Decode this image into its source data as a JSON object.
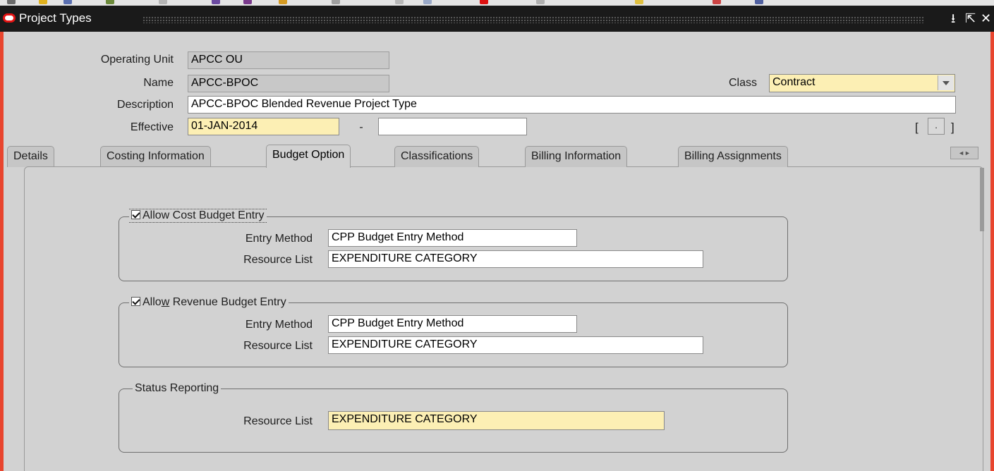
{
  "window": {
    "title": "Project Types"
  },
  "header": {
    "operating_unit": {
      "label": "Operating Unit",
      "value": "APCC OU"
    },
    "name": {
      "label": "Name",
      "value": "APCC-BPOC"
    },
    "class": {
      "label": "Class",
      "value": "Contract"
    },
    "description": {
      "label": "Description",
      "value": "APCC-BPOC Blended Revenue Project Type"
    },
    "effective": {
      "label": "Effective",
      "from": "01-JAN-2014",
      "separator": "-",
      "to": ""
    },
    "dff": {
      "open": "[",
      "close": "]",
      "button": "."
    }
  },
  "tabs": [
    {
      "label": "Details"
    },
    {
      "label": "Costing Information"
    },
    {
      "label": "Budget Option",
      "active": true
    },
    {
      "label": "Classifications"
    },
    {
      "label": "Billing Information"
    },
    {
      "label": "Billing Assignments"
    }
  ],
  "tab_scroll_glyph": "◄►",
  "cost_budget": {
    "checkbox_label": "Allow Cost Budget Entry",
    "checked": true,
    "entry_method_label": "Entry Method",
    "entry_method": "CPP Budget Entry Method",
    "resource_list_label": "Resource List",
    "resource_list": "EXPENDITURE CATEGORY"
  },
  "revenue_budget": {
    "checkbox_label_pre": "Allo",
    "checkbox_label_accel": "w",
    "checkbox_label_post": " Revenue Budget Entry",
    "checked": true,
    "entry_method_label": "Entry Method",
    "entry_method": "CPP Budget Entry Method",
    "resource_list_label": "Resource List",
    "resource_list": "EXPENDITURE CATEGORY"
  },
  "status_reporting": {
    "title": "Status Reporting",
    "resource_list_label": "Resource List",
    "resource_list": "EXPENDITURE CATEGORY"
  },
  "colors": {
    "frame_border": "#e8452e",
    "required_field": "#fcefb4",
    "title_bar": "#1a1a1a"
  }
}
